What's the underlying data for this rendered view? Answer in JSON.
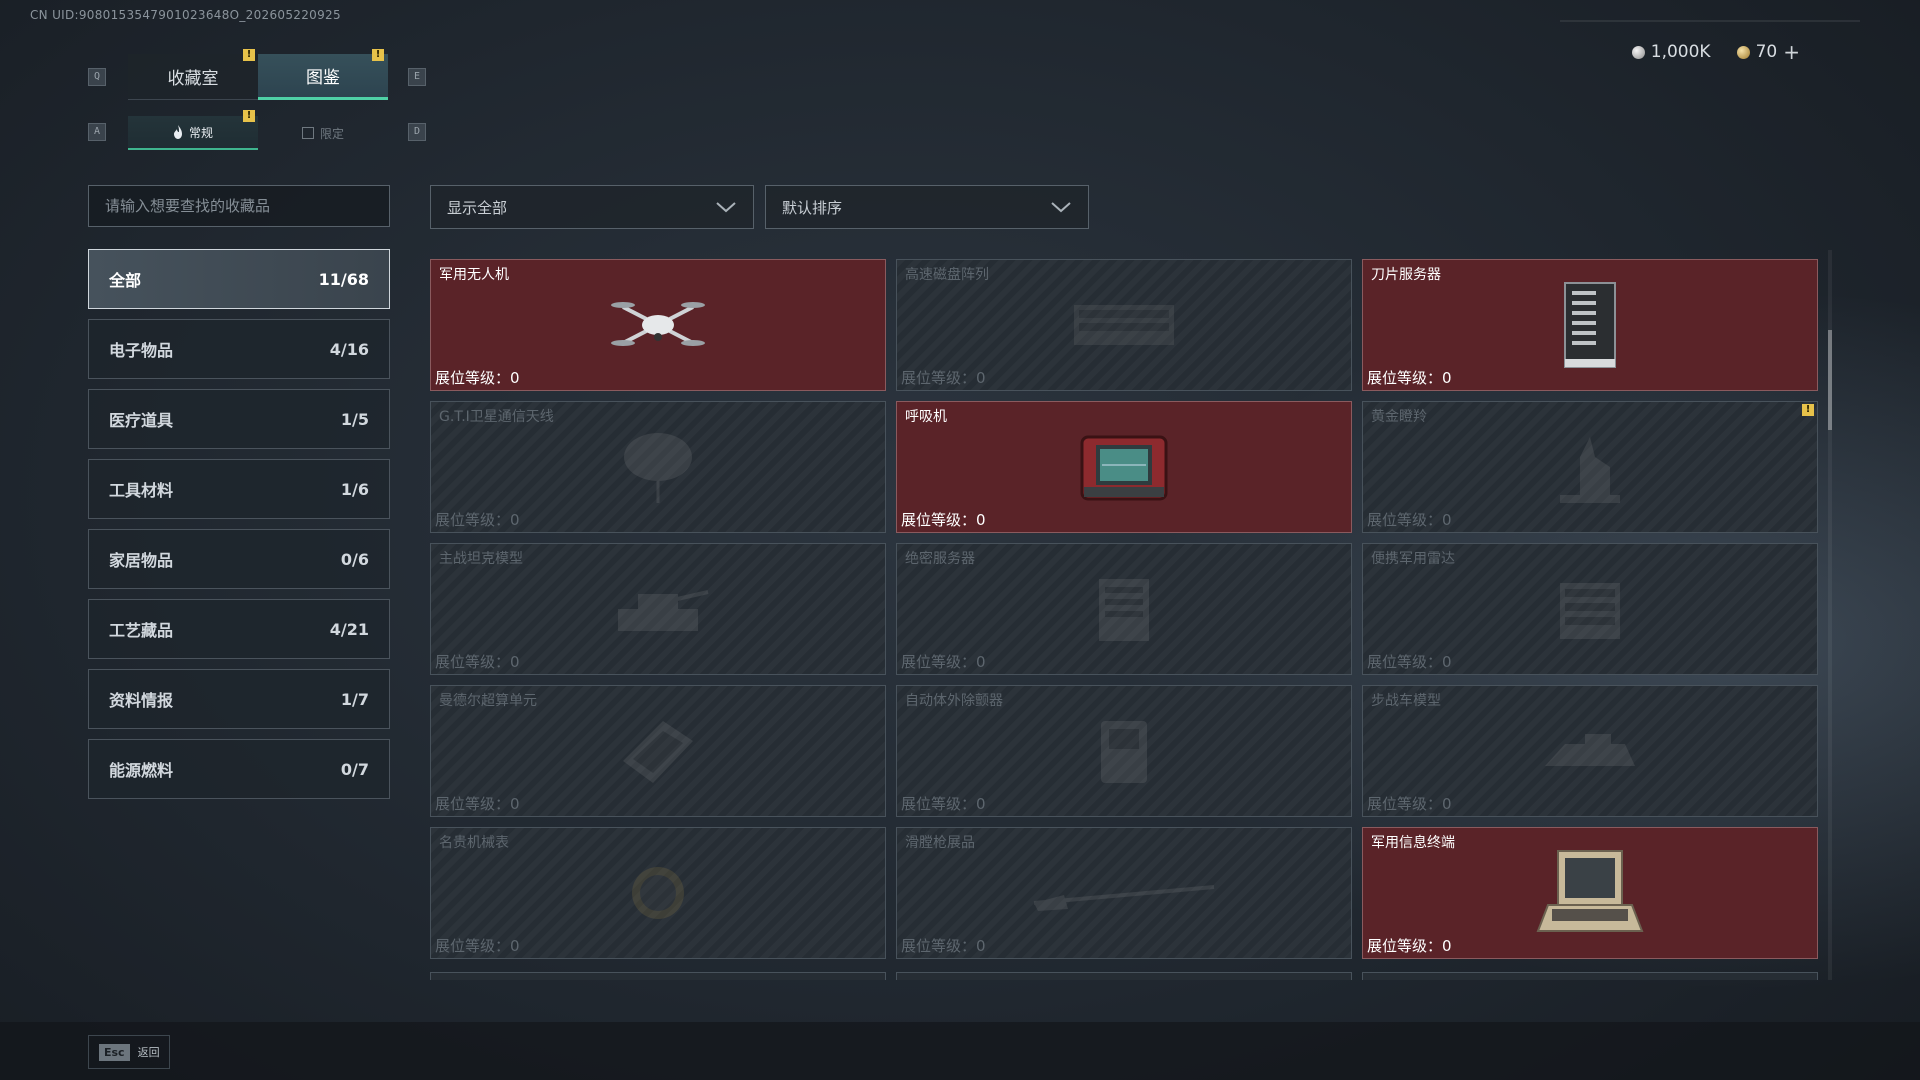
{
  "uid": "CN UID:9080153547901023648O_202605220925",
  "currency": {
    "silver": "1,000K",
    "gold": "70",
    "add_label": "+"
  },
  "tabs": {
    "key_left": "Q",
    "key_right": "E",
    "items": [
      {
        "label": "收藏室"
      },
      {
        "label": "图鉴"
      }
    ],
    "active": "图鉴"
  },
  "subtabs": {
    "key_left": "A",
    "key_right": "D",
    "items": [
      {
        "label": "常规"
      },
      {
        "label": "限定"
      }
    ],
    "active": "常规"
  },
  "badge": "!",
  "search": {
    "placeholder": "请输入想要查找的收藏品"
  },
  "categories": [
    {
      "label": "全部",
      "count": "11/68"
    },
    {
      "label": "电子物品",
      "count": "4/16"
    },
    {
      "label": "医疗道具",
      "count": "1/5"
    },
    {
      "label": "工具材料",
      "count": "1/6"
    },
    {
      "label": "家居物品",
      "count": "0/6"
    },
    {
      "label": "工艺藏品",
      "count": "4/21"
    },
    {
      "label": "资料情报",
      "count": "1/7"
    },
    {
      "label": "能源燃料",
      "count": "0/7"
    }
  ],
  "filters": {
    "show": "显示全部",
    "sort": "默认排序"
  },
  "level_label": "展位等级：",
  "items": [
    {
      "name": "军用无人机",
      "level": "0",
      "owned": true,
      "icon": "drone-icon"
    },
    {
      "name": "高速磁盘阵列",
      "level": "0",
      "owned": false,
      "icon": "disk-array-icon"
    },
    {
      "name": "刀片服务器",
      "level": "0",
      "owned": true,
      "icon": "blade-server-icon"
    },
    {
      "name": "G.T.I卫星通信天线",
      "level": "0",
      "owned": false,
      "icon": "satellite-dish-icon"
    },
    {
      "name": "呼吸机",
      "level": "0",
      "owned": true,
      "icon": "ventilator-icon"
    },
    {
      "name": "黄金瞪羚",
      "level": "0",
      "owned": false,
      "icon": "gazelle-statue-icon",
      "badge": true
    },
    {
      "name": "主战坦克模型",
      "level": "0",
      "owned": false,
      "icon": "tank-model-icon"
    },
    {
      "name": "绝密服务器",
      "level": "0",
      "owned": false,
      "icon": "server-icon"
    },
    {
      "name": "便携军用雷达",
      "level": "0",
      "owned": false,
      "icon": "radar-icon"
    },
    {
      "name": "曼德尔超算单元",
      "level": "0",
      "owned": false,
      "icon": "supercomputer-unit-icon"
    },
    {
      "name": "自动体外除颤器",
      "level": "0",
      "owned": false,
      "icon": "defibrillator-icon"
    },
    {
      "name": "步战车模型",
      "level": "0",
      "owned": false,
      "icon": "ifv-model-icon"
    },
    {
      "name": "名贵机械表",
      "level": "0",
      "owned": false,
      "icon": "watch-icon"
    },
    {
      "name": "滑膛枪展品",
      "level": "0",
      "owned": false,
      "icon": "musket-icon"
    },
    {
      "name": "军用信息终端",
      "level": "0",
      "owned": true,
      "icon": "info-terminal-icon"
    }
  ],
  "footer": {
    "esc_key": "Esc",
    "esc_label": "返回"
  },
  "colors": {
    "owned_bg": "#5a2328",
    "locked_bg": "#262d34",
    "accent": "#4fd1a6",
    "badge": "#e7c24a"
  }
}
